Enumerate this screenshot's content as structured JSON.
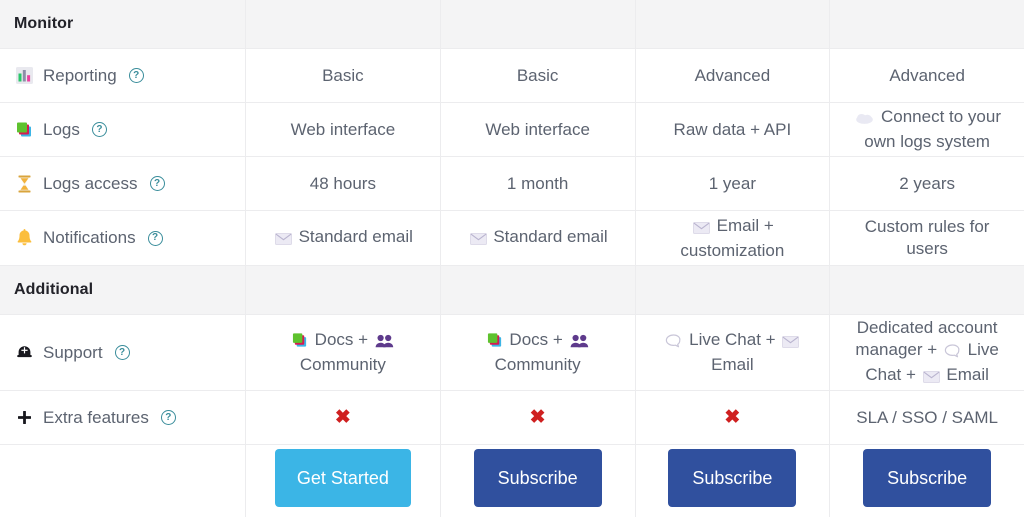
{
  "sections": [
    {
      "title": "Monitor"
    },
    {
      "title": "Additional"
    }
  ],
  "colors": {
    "get_started_button": "#3bb5e6",
    "subscribe_button": "#30509e",
    "section_header_bg": "#f4f4f5",
    "cross_red": "#cf2020",
    "help_icon": "#3a8d9b",
    "body_text": "#5c6370"
  },
  "monitor": {
    "title": "Monitor",
    "rows": [
      {
        "icon": "bar-chart-icon",
        "label": "Reporting",
        "help": "?",
        "values": [
          {
            "text": "Basic"
          },
          {
            "text": "Basic"
          },
          {
            "text": "Advanced"
          },
          {
            "text": "Advanced"
          }
        ]
      },
      {
        "icon": "books-icon",
        "label": "Logs",
        "help": "?",
        "values": [
          {
            "text": "Web interface"
          },
          {
            "text": "Web interface"
          },
          {
            "text": "Raw data + API"
          },
          {
            "icon": "cloud-icon",
            "text": "Connect to your own logs system"
          }
        ]
      },
      {
        "icon": "hourglass-icon",
        "label": "Logs access",
        "help": "?",
        "values": [
          {
            "text": "48 hours"
          },
          {
            "text": "1 month"
          },
          {
            "text": "1 year"
          },
          {
            "text": "2 years"
          }
        ]
      },
      {
        "icon": "bell-icon",
        "label": "Notifications",
        "help": "?",
        "values": [
          {
            "icon": "envelope-icon",
            "text": "Standard email"
          },
          {
            "icon": "envelope-icon",
            "text": "Standard email"
          },
          {
            "icon": "envelope-icon",
            "text": "Email + customization"
          },
          {
            "text": "Custom rules for users"
          }
        ]
      }
    ]
  },
  "additional": {
    "title": "Additional",
    "rows": [
      {
        "icon": "helmet-icon",
        "label": "Support",
        "help": "?",
        "values": [
          {
            "text_parts": [
              "Docs",
              "+",
              "Community"
            ],
            "icons": [
              "books-icon",
              "people-icon"
            ]
          },
          {
            "text_parts": [
              "Docs",
              "+",
              "Community"
            ],
            "icons": [
              "books-icon",
              "people-icon"
            ]
          },
          {
            "text_parts": [
              "Live Chat",
              "+",
              "Email"
            ],
            "icons": [
              "speech-bubble-icon",
              "envelope-icon"
            ]
          },
          {
            "text_parts": [
              "Dedicated account manager",
              "+",
              "Live Chat",
              "+",
              "Email"
            ],
            "icons": [
              "speech-bubble-icon",
              "envelope-icon"
            ]
          }
        ]
      },
      {
        "icon": "plus-icon",
        "label": "Extra features",
        "help": "?",
        "values": [
          {
            "mark": "cross",
            "text": "✖"
          },
          {
            "mark": "cross",
            "text": "✖"
          },
          {
            "mark": "cross",
            "text": "✖"
          },
          {
            "text": "SLA / SSO / SAML"
          }
        ]
      }
    ]
  },
  "cta": {
    "buttons": [
      {
        "label": "Get Started",
        "style": "light"
      },
      {
        "label": "Subscribe",
        "style": "dark"
      },
      {
        "label": "Subscribe",
        "style": "dark"
      },
      {
        "label": "Subscribe",
        "style": "dark"
      }
    ]
  },
  "support_cells": {
    "c1_line1": "Docs +",
    "c1_line2": "Community",
    "c2_line1": "Docs +",
    "c2_line2": "Community",
    "c3_line1": "Live Chat +",
    "c3_line2": "Email",
    "c4_line1": "Dedicated account",
    "c4_line2": "manager +",
    "c4_line2b": "Live",
    "c4_line3": "Chat +",
    "c4_line3b": "Email"
  },
  "logs_cell4": {
    "line1": "Connect to your",
    "line2": "own logs system"
  },
  "notif_cell3": {
    "line1": "Email +",
    "line2": "customization"
  },
  "notif_cell4": {
    "line1": "Custom rules for",
    "line2": "users"
  }
}
